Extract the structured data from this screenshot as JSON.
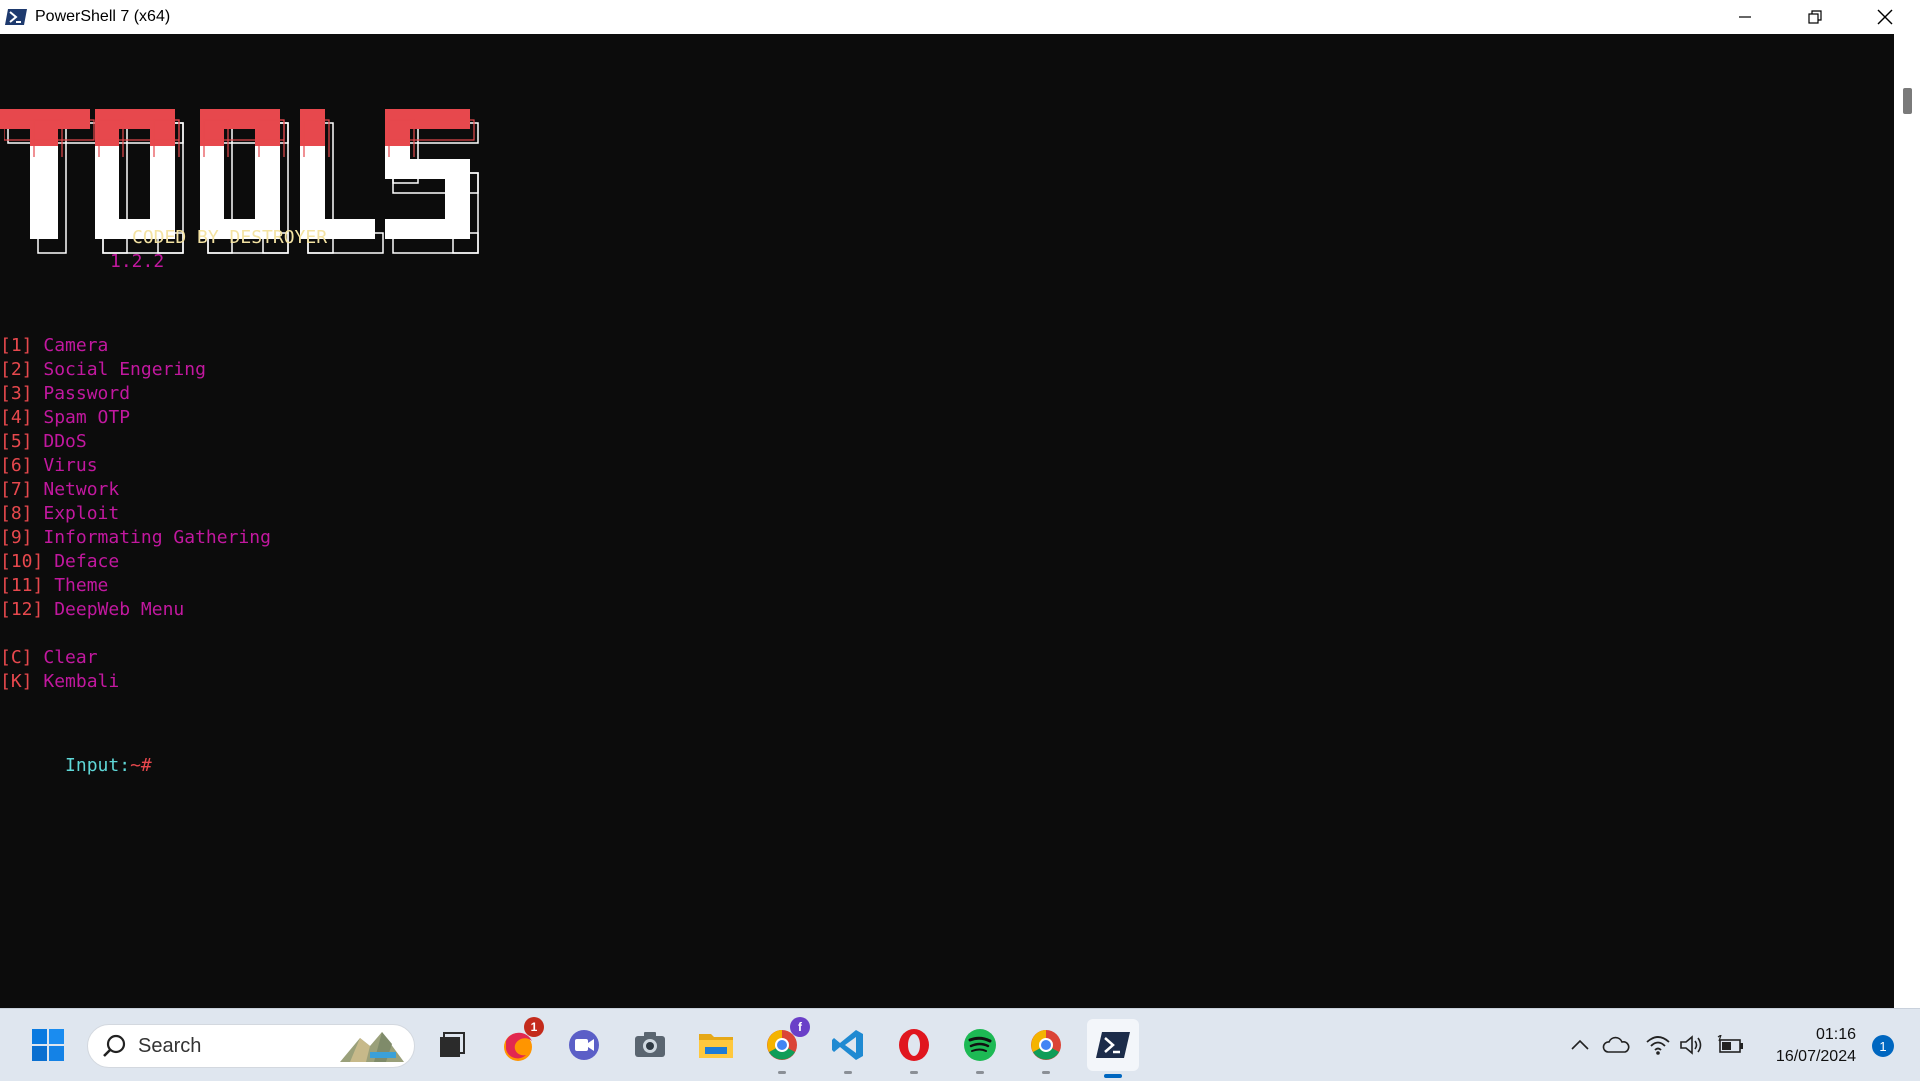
{
  "window": {
    "title": "PowerShell 7 (x64)"
  },
  "terminal": {
    "banner_text": "TOOLS",
    "credit": "CODED BY DESTROYER",
    "version": "1.2.2",
    "menu": [
      {
        "key": "[1]",
        "label": "Camera"
      },
      {
        "key": "[2]",
        "label": "Social Engering"
      },
      {
        "key": "[3]",
        "label": "Password"
      },
      {
        "key": "[4]",
        "label": "Spam OTP"
      },
      {
        "key": "[5]",
        "label": "DDoS"
      },
      {
        "key": "[6]",
        "label": "Virus"
      },
      {
        "key": "[7]",
        "label": "Network"
      },
      {
        "key": "[8]",
        "label": "Exploit"
      },
      {
        "key": "[9]",
        "label": "Informating Gathering"
      },
      {
        "key": "[10]",
        "label": "Deface"
      },
      {
        "key": "[11]",
        "label": "Theme"
      },
      {
        "key": "[12]",
        "label": "DeepWeb Menu"
      }
    ],
    "extra": [
      {
        "key": "[C]",
        "label": "Clear"
      },
      {
        "key": "[K]",
        "label": "Kembali"
      }
    ],
    "prompt_label": "Input:",
    "prompt_symbol": "~#"
  },
  "taskbar": {
    "search_placeholder": "Search",
    "firefox_badge": "1",
    "chrome_profile_badge": "f",
    "time": "01:16",
    "date": "16/07/2024",
    "notification_count": "1"
  },
  "colors": {
    "terminal_bg": "#0c0c0c",
    "banner_red": "#e7484d",
    "banner_white": "#ffffff",
    "bracket": "#e7484d",
    "label": "#c2189f",
    "credit": "#f4e3a3",
    "prompt_cyan": "#5fd7d7"
  }
}
